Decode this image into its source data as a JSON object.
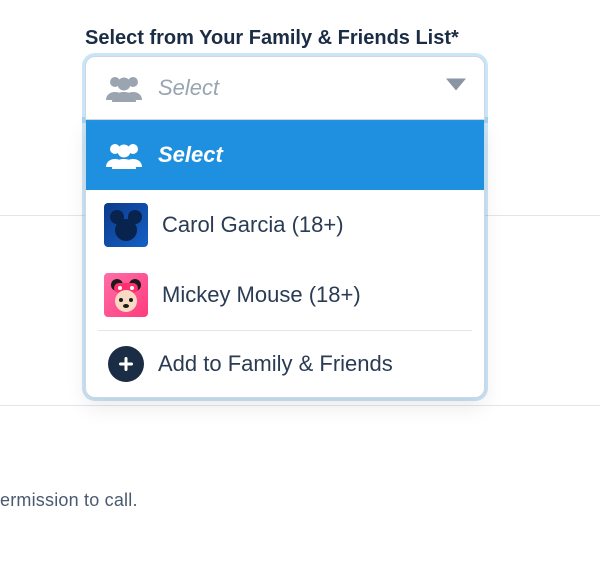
{
  "colors": {
    "accent": "#1f8fe0",
    "text": "#253b56",
    "muted": "#9aa5b1"
  },
  "field": {
    "label": "Select from Your Family & Friends List*"
  },
  "select": {
    "placeholder": "Select"
  },
  "options": [
    {
      "kind": "placeholder",
      "label": "Select",
      "highlighted": true
    },
    {
      "kind": "person",
      "name": "Carol Garcia",
      "age_badge": "(18+)",
      "avatar": "mickey-head"
    },
    {
      "kind": "person",
      "name": "Mickey Mouse",
      "age_badge": "(18+)",
      "avatar": "minnie"
    }
  ],
  "add_action": {
    "label": "Add to Family & Friends"
  },
  "footer_fragment": "ermission to call."
}
